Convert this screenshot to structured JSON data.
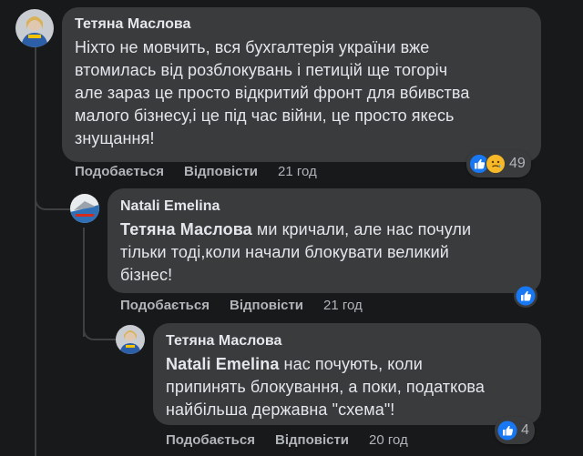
{
  "comments": [
    {
      "author": "Тетяна Маслова",
      "lines": [
        "Ніхто не мовчить, вся бухгалтерія україни вже",
        "втомилась від розблокувань і петицій ще тогоріч",
        "але зараз це просто відкритий фронт для вбивства",
        "малого бізнесу,і це під час війни, це просто якесь",
        "знущання!"
      ],
      "like_label": "Подобається",
      "reply_label": "Відповісти",
      "time": "21 год",
      "reaction_count": "49",
      "reaction_icons": [
        "like-icon",
        "care-icon"
      ]
    },
    {
      "author": "Natali Emelina",
      "mention": "Тетяна Маслова",
      "line1_rest": " ми кричали, але нас почули",
      "lines": [
        "тільки тоді,коли начали блокувати великий",
        "бізнес!"
      ],
      "like_label": "Подобається",
      "reply_label": "Відповісти",
      "time": "21 год",
      "reaction_icons": [
        "like-icon"
      ]
    },
    {
      "author": "Тетяна Маслова",
      "mention": "Natali Emelina",
      "line1_rest": " нас почують, коли",
      "lines": [
        "припинять блокування, а поки, податкова",
        "найбільша державна \"схема\"!"
      ],
      "like_label": "Подобається",
      "reply_label": "Відповісти",
      "time": "20 год",
      "reaction_count": "4",
      "reaction_icons": [
        "like-icon"
      ]
    }
  ],
  "colors": {
    "background": "#18191a",
    "bubble": "#3a3b3c",
    "text": "#e4e6eb",
    "secondary_text": "#b0b3b8",
    "like_blue": "#1877f2"
  }
}
